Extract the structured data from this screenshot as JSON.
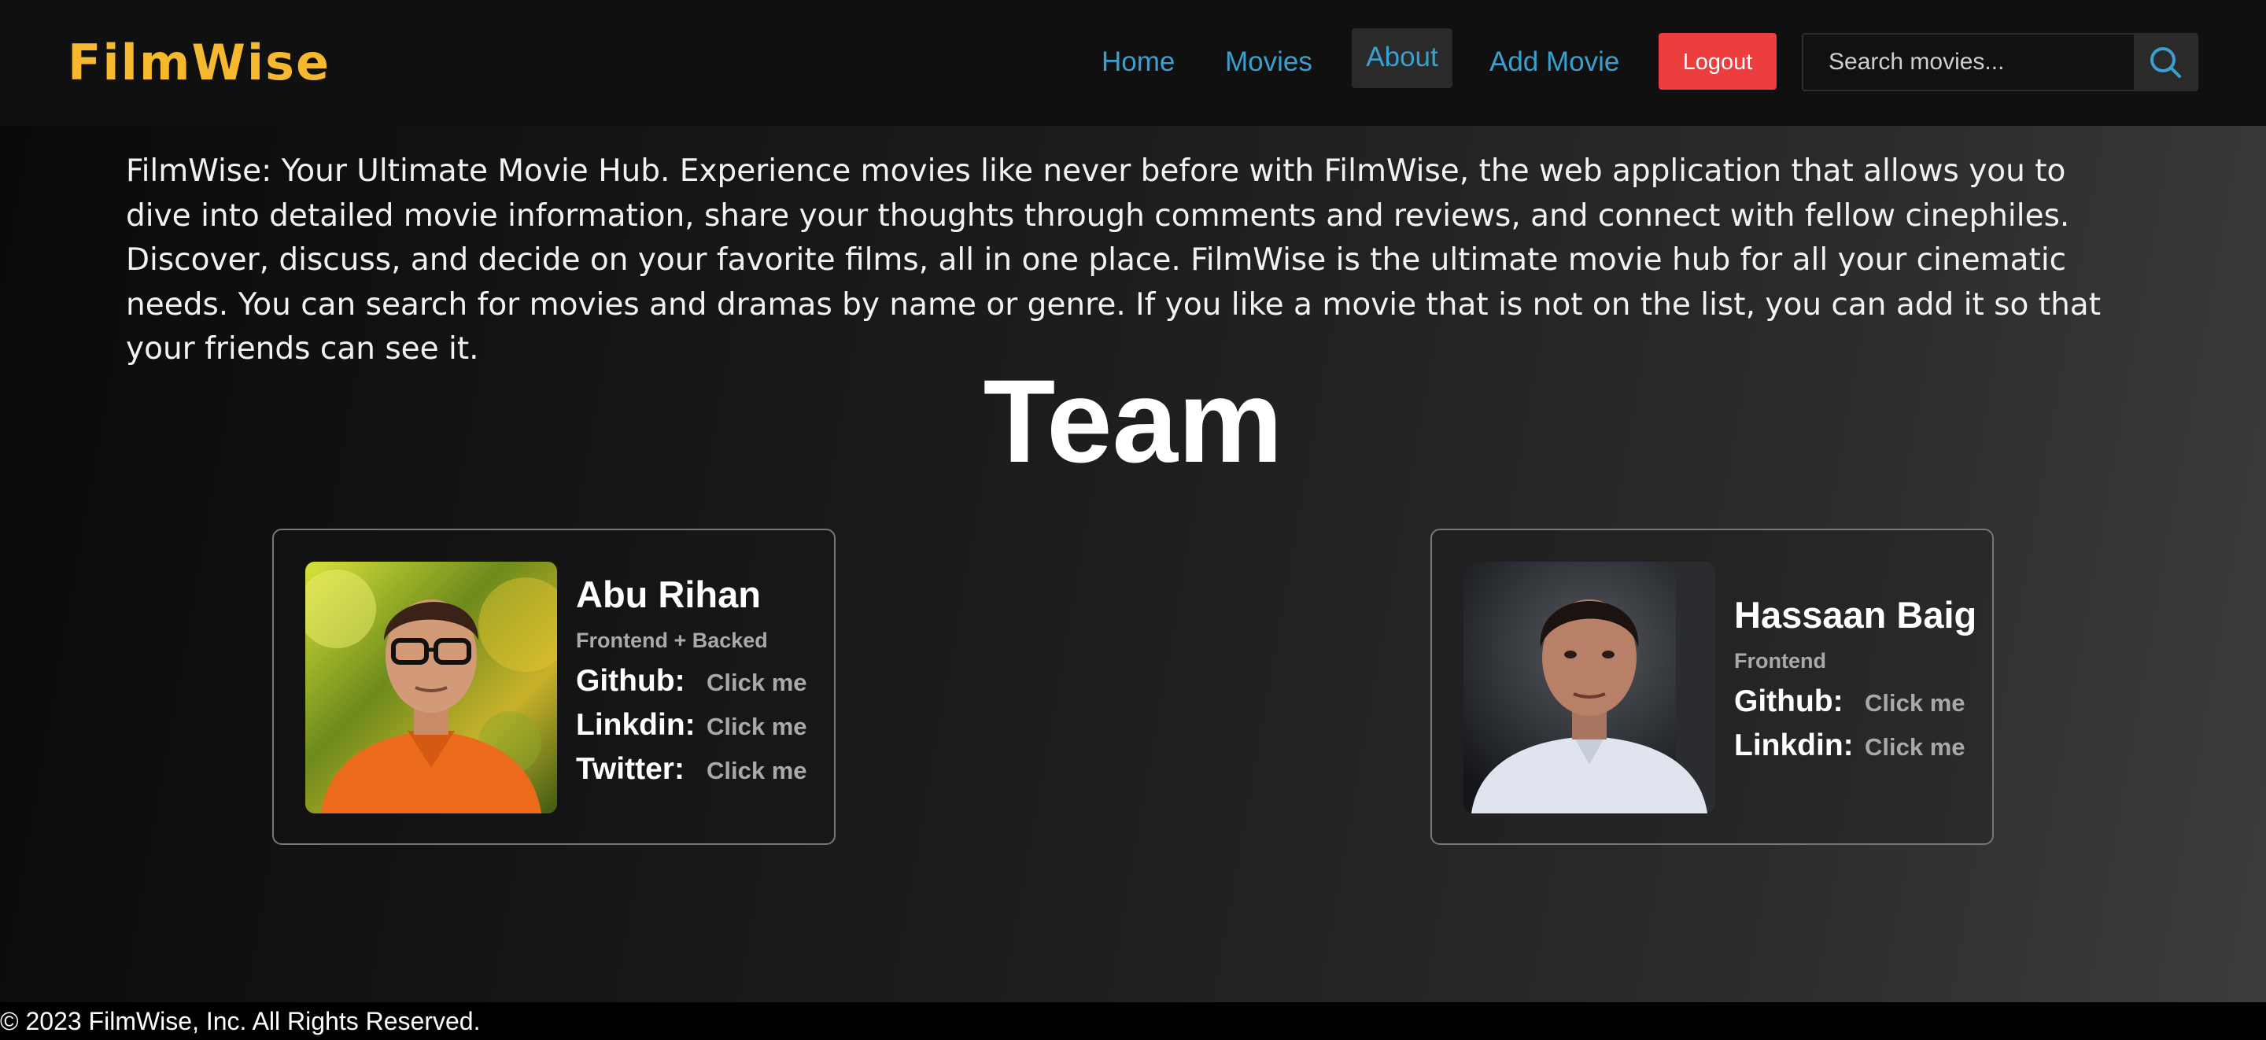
{
  "navbar": {
    "brand": "FilmWise",
    "links": {
      "home": "Home",
      "movies": "Movies",
      "about": "About",
      "add_movie": "Add Movie"
    },
    "logout_label": "Logout",
    "search_placeholder": "Search movies...",
    "search_icon": "search-icon"
  },
  "intro": {
    "text": "FilmWise: Your Ultimate Movie Hub. Experience movies like never before with FilmWise, the web application that allows you to dive into detailed movie information, share your thoughts through comments and reviews, and connect with fellow cinephiles. Discover, discuss, and decide on your favorite films, all in one place. FilmWise is the ultimate movie hub for all your cinematic needs. You can search for movies and dramas by name or genre. If you like a movie that is not on the list, you can add it so that your friends can see it."
  },
  "team": {
    "heading": "Team",
    "members": [
      {
        "name": "Abu Rihan",
        "role": "Frontend + Backed",
        "links": [
          {
            "label": "Github:",
            "action": "Click me"
          },
          {
            "label": "Linkdin:",
            "action": "Click me"
          },
          {
            "label": "Twitter:",
            "action": "Click me"
          }
        ]
      },
      {
        "name": "Hassaan Baig",
        "role": "Frontend",
        "links": [
          {
            "label": "Github:",
            "action": "Click me"
          },
          {
            "label": "Linkdin:",
            "action": "Click me"
          }
        ]
      }
    ]
  },
  "footer": {
    "text": "© 2023 FilmWise, Inc. All Rights Reserved."
  },
  "colors": {
    "brand": "#f5b82e",
    "nav_link": "#3aa0cf",
    "logout": "#ec3d3f",
    "muted_text": "#a9a9a9"
  }
}
